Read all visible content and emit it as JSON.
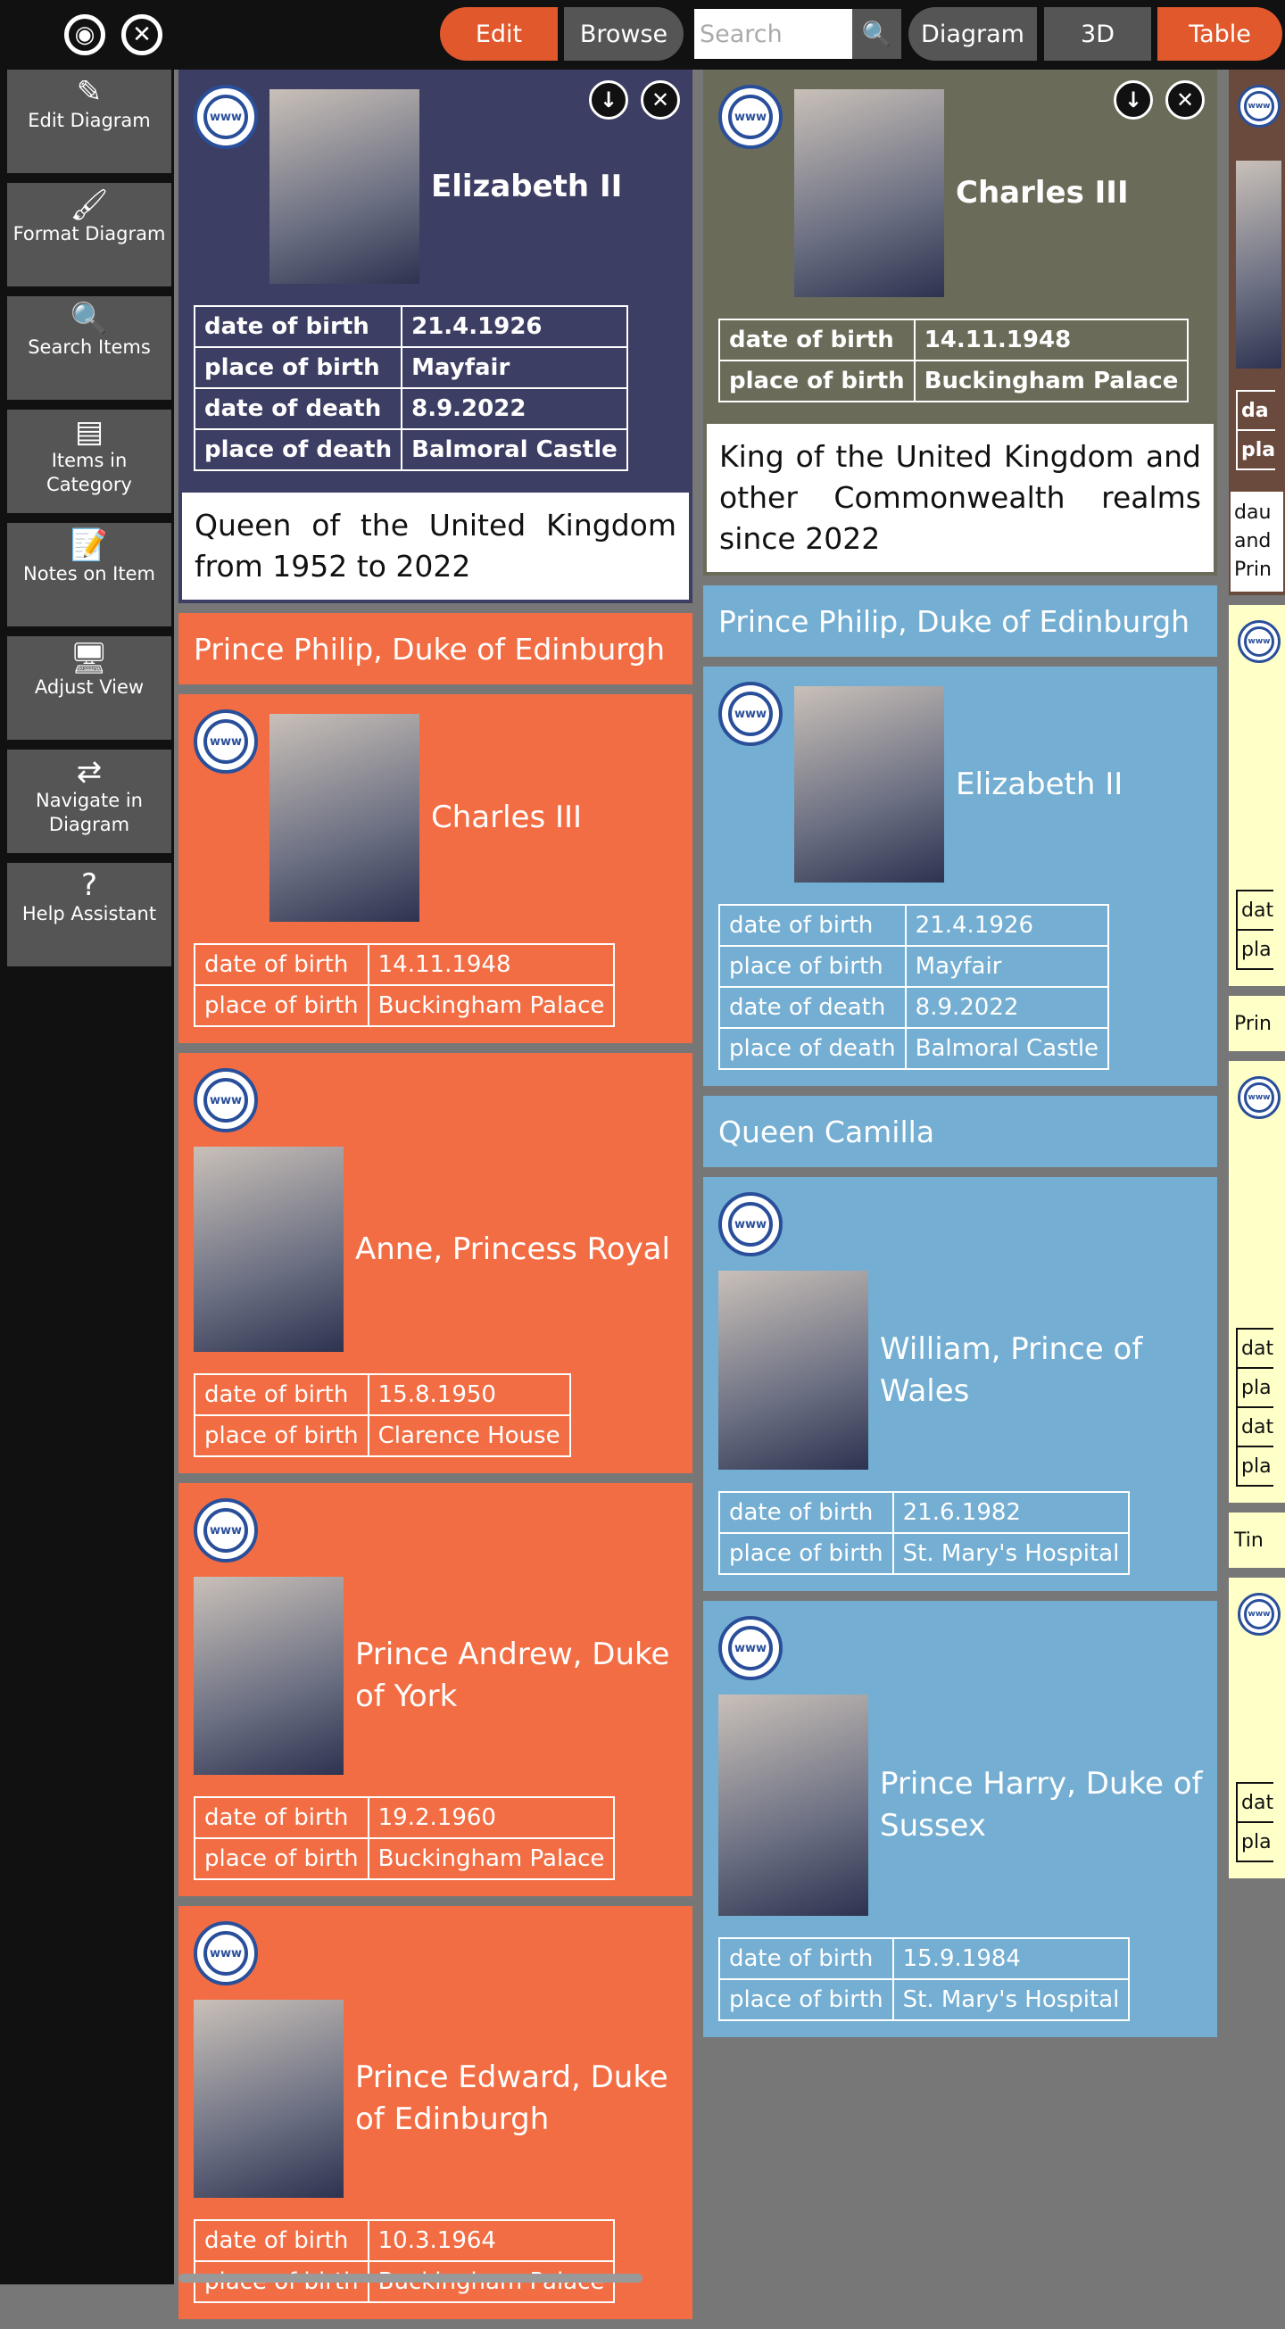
{
  "topbar": {
    "target_icon": "target-icon",
    "close_icon": "close-icon",
    "edit": "Edit",
    "browse": "Browse",
    "search_placeholder": "Search",
    "diagram": "Diagram",
    "view_3d": "3D",
    "table": "Table"
  },
  "sidebar": [
    {
      "icon": "pencil-icon",
      "glyph": "✎",
      "label": "Edit Diagram"
    },
    {
      "icon": "brush-icon",
      "glyph": "🖌",
      "label": "Format Diagram"
    },
    {
      "icon": "search-icon",
      "glyph": "🔍",
      "label": "Search Items"
    },
    {
      "icon": "list-icon",
      "glyph": "▤",
      "label": "Items in Category"
    },
    {
      "icon": "notes-icon",
      "glyph": "📝",
      "label": "Notes on Item"
    },
    {
      "icon": "monitor-icon",
      "glyph": "🖥",
      "label": "Adjust View"
    },
    {
      "icon": "arrows-icon",
      "glyph": "⇄",
      "label": "Navigate in Diagram"
    },
    {
      "icon": "help-icon",
      "glyph": "?",
      "label": "Help Assistant"
    }
  ],
  "colors": {
    "navy": "#3d3e63",
    "olive": "#6b6b59",
    "orange": "#f26d43",
    "blue": "#74aed2",
    "brown": "#6b4a3e",
    "yellow": "#ffffc8",
    "accent": "#e0582c"
  },
  "columns": [
    [
      {
        "type": "card",
        "variant": "a",
        "bg": "#3d3e63",
        "bold": true,
        "controls": true,
        "name": "Elizabeth II",
        "photo_h": 218,
        "facts": [
          [
            "date of birth",
            "21.4.1926"
          ],
          [
            "place of birth",
            "Mayfair"
          ],
          [
            "date of death",
            "8.9.2022"
          ],
          [
            "place of death",
            "Balmoral Castle"
          ]
        ],
        "desc": "Queen of the United Kingdom from 1952 to 2022"
      },
      {
        "type": "header",
        "bg": "#f26d43",
        "text": "Prince Philip, Duke of Edinburgh"
      },
      {
        "type": "card",
        "variant": "a",
        "bg": "#f26d43",
        "name": "Charles III",
        "photo_h": 233,
        "facts": [
          [
            "date of birth",
            "14.11.1948"
          ],
          [
            "place of birth",
            "Buckingham Palace"
          ]
        ]
      },
      {
        "type": "card",
        "variant": "b",
        "bg": "#f26d43",
        "name": "Anne, Princess Royal",
        "photo_h": 230,
        "facts": [
          [
            "date of birth",
            "15.8.1950"
          ],
          [
            "place of birth",
            "Clarence House"
          ]
        ]
      },
      {
        "type": "card",
        "variant": "b",
        "bg": "#f26d43",
        "name": "Prince Andrew, Duke of York",
        "photo_h": 222,
        "facts": [
          [
            "date of birth",
            "19.2.1960"
          ],
          [
            "place of birth",
            "Buckingham Palace"
          ]
        ]
      },
      {
        "type": "card",
        "variant": "b",
        "bg": "#f26d43",
        "name": "Prince Edward, Duke of Edinburgh",
        "photo_h": 222,
        "facts": [
          [
            "date of birth",
            "10.3.1964"
          ],
          [
            "place of birth",
            "Buckingham Palace"
          ]
        ]
      }
    ],
    [
      {
        "type": "card",
        "variant": "a",
        "bg": "#6b6b59",
        "bold": true,
        "controls": true,
        "name": "Charles III",
        "photo_h": 233,
        "facts": [
          [
            "date of birth",
            "14.11.1948"
          ],
          [
            "place of birth",
            "Buckingham Palace"
          ]
        ],
        "desc": "King of the United Kingdom and other Commonwealth realms since 2022"
      },
      {
        "type": "header",
        "bg": "#74aed2",
        "text": "Prince Philip, Duke of Edinburgh"
      },
      {
        "type": "card",
        "variant": "a",
        "bg": "#74aed2",
        "name": "Elizabeth II",
        "photo_h": 220,
        "facts": [
          [
            "date of birth",
            "21.4.1926"
          ],
          [
            "place of birth",
            "Mayfair"
          ],
          [
            "date of death",
            "8.9.2022"
          ],
          [
            "place of death",
            "Balmoral Castle"
          ]
        ]
      },
      {
        "type": "header",
        "bg": "#74aed2",
        "text": "Queen Camilla"
      },
      {
        "type": "card",
        "variant": "b",
        "bg": "#74aed2",
        "name": "William, Prince of Wales",
        "photo_h": 223,
        "facts": [
          [
            "date of birth",
            "21.6.1982"
          ],
          [
            "place of birth",
            "St. Mary's Hospital"
          ]
        ]
      },
      {
        "type": "card",
        "variant": "b",
        "bg": "#74aed2",
        "name": "Prince Harry, Duke of Sussex",
        "photo_h": 248,
        "facts": [
          [
            "date of birth",
            "15.9.1984"
          ],
          [
            "place of birth",
            "St. Mary's Hospital"
          ]
        ]
      }
    ],
    [
      {
        "type": "card",
        "variant": "c",
        "bg": "#6b4a3e",
        "bold": true,
        "name": "",
        "photo_h": 233,
        "facts": [
          [
            "da",
            ""
          ],
          [
            "pla",
            ""
          ]
        ],
        "desc": "dau and Prin"
      },
      {
        "type": "card",
        "variant": "y",
        "bg": "#ffffc8",
        "yellow": true,
        "name": "",
        "photo_h": 190,
        "facts": [
          [
            "dat",
            ""
          ],
          [
            "pla",
            ""
          ]
        ]
      },
      {
        "type": "header",
        "bg": "#ffffc8",
        "yellow": true,
        "text": "Prin"
      },
      {
        "type": "card",
        "variant": "y",
        "bg": "#ffffc8",
        "yellow": true,
        "name": "",
        "photo_h": 170,
        "facts": [
          [
            "dat",
            ""
          ],
          [
            "pla",
            ""
          ],
          [
            "dat",
            ""
          ],
          [
            "pla",
            ""
          ]
        ]
      },
      {
        "type": "header",
        "bg": "#ffffc8",
        "yellow": true,
        "text": "Tin"
      },
      {
        "type": "card",
        "variant": "y",
        "bg": "#ffffc8",
        "yellow": true,
        "name": "",
        "photo_h": 100,
        "facts": [
          [
            "dat",
            ""
          ],
          [
            "pla",
            ""
          ]
        ]
      }
    ]
  ]
}
